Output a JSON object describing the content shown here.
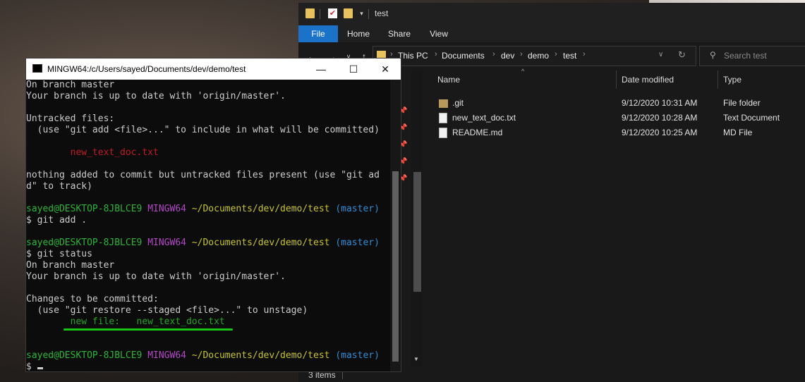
{
  "explorer": {
    "title": "test",
    "ribbon_tabs": [
      "File",
      "Home",
      "Share",
      "View"
    ],
    "breadcrumbs": [
      "This PC",
      "Documents",
      "dev",
      "demo",
      "test"
    ],
    "search_placeholder": "Search test",
    "columns": [
      "Name",
      "Date modified",
      "Type"
    ],
    "files": [
      {
        "name": ".git",
        "date": "9/12/2020 10:31 AM",
        "type": "File folder",
        "icon": "folder-icon"
      },
      {
        "name": "new_text_doc.txt",
        "date": "9/12/2020 10:28 AM",
        "type": "Text Document",
        "icon": "text-file-icon"
      },
      {
        "name": "README.md",
        "date": "9/12/2020 10:25 AM",
        "type": "MD File",
        "icon": "file-icon"
      }
    ],
    "status": "3 items"
  },
  "terminal": {
    "title": "MINGW64:/c/Users/sayed/Documents/dev/demo/test",
    "lines": [
      [
        {
          "t": "On branch master",
          "c": ""
        }
      ],
      [
        {
          "t": "Your branch is up to date with 'origin/master'.",
          "c": ""
        }
      ],
      [
        {
          "t": "",
          "c": ""
        }
      ],
      [
        {
          "t": "Untracked files:",
          "c": ""
        }
      ],
      [
        {
          "t": "  (use \"git add <file>...\" to include in what will be committed)",
          "c": ""
        }
      ],
      [
        {
          "t": "",
          "c": ""
        }
      ],
      [
        {
          "t": "        new_text_doc.txt",
          "c": "red"
        }
      ],
      [
        {
          "t": "",
          "c": ""
        }
      ],
      [
        {
          "t": "nothing added to commit but untracked files present (use \"git ad",
          "c": ""
        }
      ],
      [
        {
          "t": "d\" to track)",
          "c": ""
        }
      ],
      [
        {
          "t": "",
          "c": ""
        }
      ],
      [
        {
          "t": "sayed@DESKTOP-8JBLCE9 ",
          "c": "green"
        },
        {
          "t": "MINGW64 ",
          "c": "purple"
        },
        {
          "t": "~/Documents/dev/demo/test ",
          "c": "yellow"
        },
        {
          "t": "(master)",
          "c": "cyan"
        }
      ],
      [
        {
          "t": "$ git add .",
          "c": ""
        }
      ],
      [
        {
          "t": "",
          "c": ""
        }
      ],
      [
        {
          "t": "sayed@DESKTOP-8JBLCE9 ",
          "c": "green"
        },
        {
          "t": "MINGW64 ",
          "c": "purple"
        },
        {
          "t": "~/Documents/dev/demo/test ",
          "c": "yellow"
        },
        {
          "t": "(master)",
          "c": "cyan"
        }
      ],
      [
        {
          "t": "$ git status",
          "c": ""
        }
      ],
      [
        {
          "t": "On branch master",
          "c": ""
        }
      ],
      [
        {
          "t": "Your branch is up to date with 'origin/master'.",
          "c": ""
        }
      ],
      [
        {
          "t": "",
          "c": ""
        }
      ],
      [
        {
          "t": "Changes to be committed:",
          "c": ""
        }
      ],
      [
        {
          "t": "  (use \"git restore --staged <file>...\" to unstage)",
          "c": ""
        }
      ],
      [
        {
          "t": "        new file:   new_text_doc.txt",
          "c": "dgreen"
        }
      ],
      [
        {
          "t": "",
          "c": ""
        }
      ],
      [
        {
          "t": "",
          "c": ""
        }
      ],
      [
        {
          "t": "sayed@DESKTOP-8JBLCE9 ",
          "c": "green"
        },
        {
          "t": "MINGW64 ",
          "c": "purple"
        },
        {
          "t": "~/Documents/dev/demo/test ",
          "c": "yellow"
        },
        {
          "t": "(master)",
          "c": "cyan"
        }
      ],
      [
        {
          "t": "$ ",
          "c": ""
        }
      ]
    ]
  },
  "colors": {
    "prompt_user": "#2bb537",
    "prompt_system": "#b148c6",
    "prompt_path": "#c7c32a",
    "prompt_branch": "#2f8ed8",
    "untracked": "#c01c28",
    "staged": "#26a326",
    "annotation_underline": "#17c617",
    "file_tab": "#1a73c8"
  }
}
